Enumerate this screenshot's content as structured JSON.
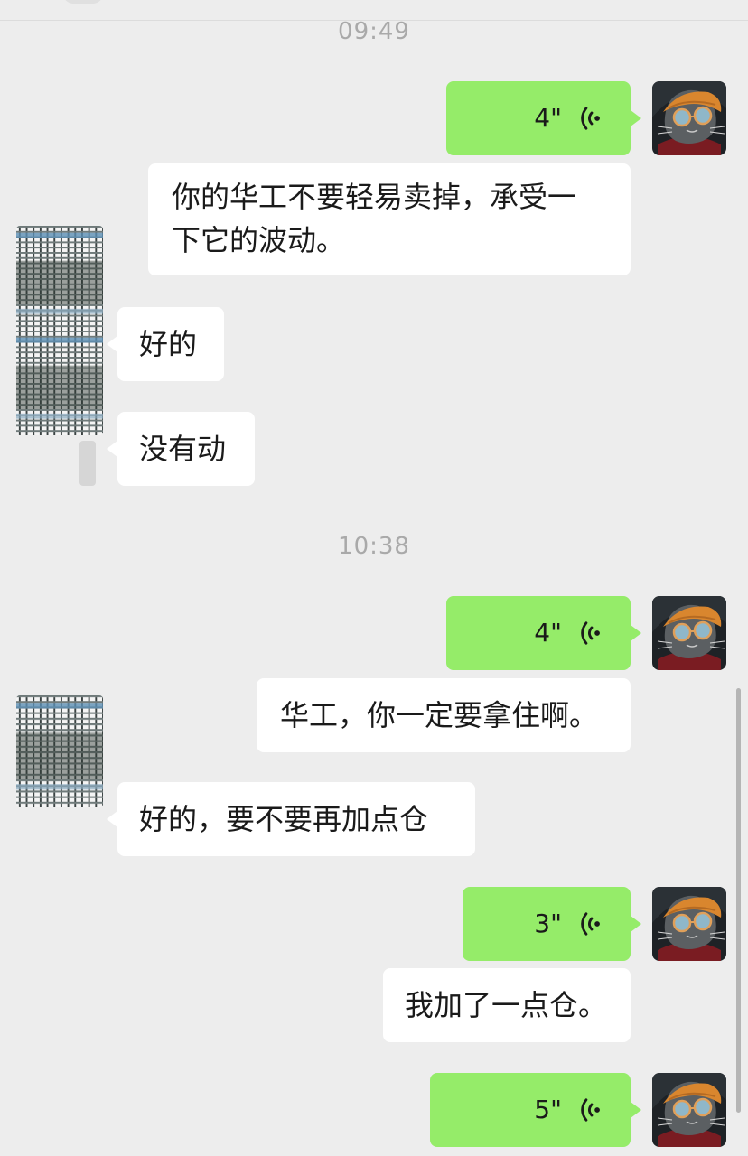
{
  "timestamps": [
    "09:49",
    "10:38"
  ],
  "messages": [
    {
      "dir": "out",
      "type": "voice",
      "duration": "4\""
    },
    {
      "dir": "out",
      "type": "text",
      "line1": "你的华工不要轻易卖掉，承受一",
      "line2": "下它的波动。"
    },
    {
      "dir": "in",
      "type": "text",
      "text": "好的"
    },
    {
      "dir": "in",
      "type": "text",
      "text": "没有动"
    },
    {
      "dir": "out",
      "type": "voice",
      "duration": "4\""
    },
    {
      "dir": "out",
      "type": "text",
      "text": "华工，你一定要拿住啊。"
    },
    {
      "dir": "in",
      "type": "text",
      "text": "好的，要不要再加点仓"
    },
    {
      "dir": "out",
      "type": "voice",
      "duration": "3\""
    },
    {
      "dir": "out",
      "type": "text",
      "text": "我加了一点仓。"
    },
    {
      "dir": "out",
      "type": "voice",
      "duration": "5\""
    }
  ],
  "icons": {
    "voice": "voice-wave-icon",
    "avatar_self": "cat-with-glasses-avatar",
    "avatar_contact": "blurred-avatar"
  },
  "colors": {
    "background": "#ededed",
    "self_bubble": "#95ec69",
    "other_bubble": "#ffffff",
    "timestamp": "#a9a9a9"
  }
}
